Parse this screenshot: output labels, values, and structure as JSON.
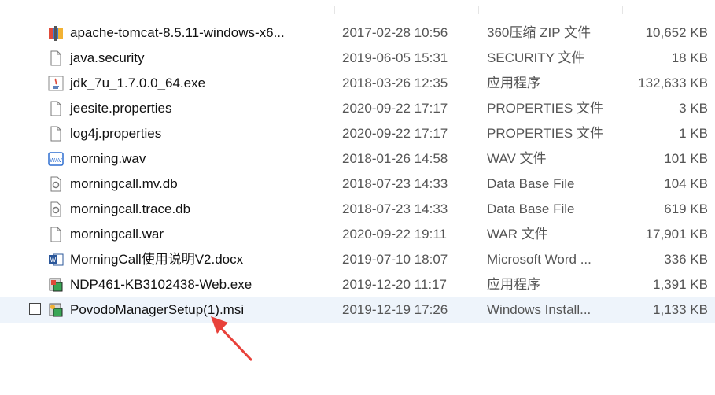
{
  "files": [
    {
      "name": "apache-tomcat-8.5.11-windows-x6...",
      "date": "2017-02-28 10:56",
      "type": "360压缩 ZIP 文件",
      "size": "10,652 KB",
      "icon": "archive-icon"
    },
    {
      "name": "java.security",
      "date": "2019-06-05 15:31",
      "type": "SECURITY 文件",
      "size": "18 KB",
      "icon": "file-icon"
    },
    {
      "name": "jdk_7u_1.7.0.0_64.exe",
      "date": "2018-03-26 12:35",
      "type": "应用程序",
      "size": "132,633 KB",
      "icon": "java-icon"
    },
    {
      "name": "jeesite.properties",
      "date": "2020-09-22 17:17",
      "type": "PROPERTIES 文件",
      "size": "3 KB",
      "icon": "file-icon"
    },
    {
      "name": "log4j.properties",
      "date": "2020-09-22 17:17",
      "type": "PROPERTIES 文件",
      "size": "1 KB",
      "icon": "file-icon"
    },
    {
      "name": "morning.wav",
      "date": "2018-01-26 14:58",
      "type": "WAV 文件",
      "size": "101 KB",
      "icon": "audio-icon"
    },
    {
      "name": "morningcall.mv.db",
      "date": "2018-07-23 14:33",
      "type": "Data Base File",
      "size": "104 KB",
      "icon": "database-icon"
    },
    {
      "name": "morningcall.trace.db",
      "date": "2018-07-23 14:33",
      "type": "Data Base File",
      "size": "619 KB",
      "icon": "database-icon"
    },
    {
      "name": "morningcall.war",
      "date": "2020-09-22 19:11",
      "type": "WAR 文件",
      "size": "17,901 KB",
      "icon": "file-icon"
    },
    {
      "name": "MorningCall使用说明V2.docx",
      "date": "2019-07-10 18:07",
      "type": "Microsoft Word ...",
      "size": "336 KB",
      "icon": "word-icon"
    },
    {
      "name": "NDP461-KB3102438-Web.exe",
      "date": "2019-12-20 11:17",
      "type": "应用程序",
      "size": "1,391 KB",
      "icon": "installer-icon"
    },
    {
      "name": "PovodoManagerSetup(1).msi",
      "date": "2019-12-19 17:26",
      "type": "Windows Install...",
      "size": "1,133 KB",
      "icon": "msi-icon",
      "hovered": true
    }
  ],
  "colors": {
    "hover_row": "#eef4fb",
    "arrow": "#e8413a"
  }
}
